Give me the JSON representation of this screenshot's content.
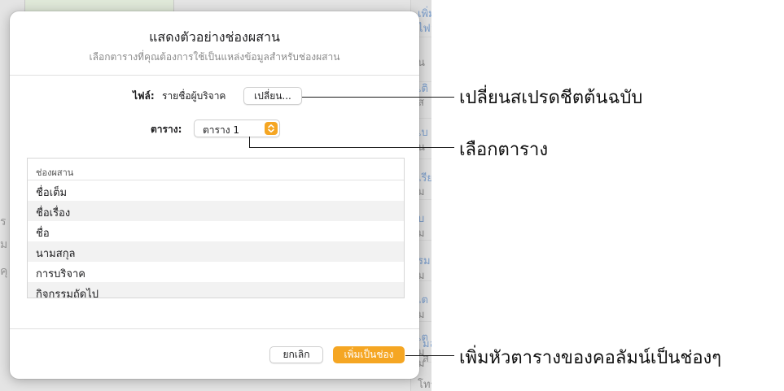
{
  "background": {
    "right_column_texts": [
      "เพิ่มช่อง",
      "ไฟล์",
      "น",
      "เติ",
      "ส",
      "เบ",
      "น",
      "เรีย",
      "ม",
      "บ",
      "ม",
      "รม",
      "ม",
      "เต",
      "ม",
      "เต",
      "ม",
      "ม",
      "มล",
      "ส",
      "โทร"
    ],
    "left_texts": [
      "ร",
      "ม",
      "คุ"
    ]
  },
  "dialog": {
    "title": "แสดงตัวอย่างช่องผสาน",
    "subtitle": "เลือกตารางที่คุณต้องการใช้เป็นแหล่งข้อมูลสำหรับช่องผสาน",
    "file_label": "ไฟล์:",
    "file_name": "รายชื่อผู้บริจาค",
    "change_button": "เปลี่ยน...",
    "table_label": "ตาราง:",
    "table_selected": "ตาราง 1",
    "fields_header": "ช่องผสาน",
    "fields": [
      "ชื่อเต็ม",
      "ชื่อเรื่อง",
      "ชื่อ",
      "นามสกุล",
      "การบริจาค",
      "กิจกรรมถัดไป"
    ],
    "cancel_button": "ยกเลิก",
    "add_button": "เพิ่มเป็นช่อง"
  },
  "callouts": {
    "change_spreadsheet": "เปลี่ยนสเปรดชีตต้นฉบับ",
    "select_table": "เลือกตาราง",
    "add_headers": "เพิ่มหัวตารางของคอลัมน์เป็นช่องๆ"
  },
  "colors": {
    "accent": "#f5a623"
  }
}
